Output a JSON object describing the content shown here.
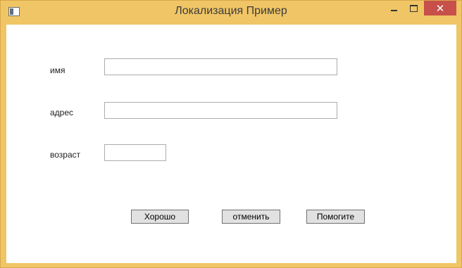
{
  "window": {
    "title": "Локализация Пример",
    "close_symbol": "✕",
    "accent_color": "#f0c566",
    "close_color": "#c7504a"
  },
  "form": {
    "name_label": "имя",
    "name_value": "",
    "address_label": "адрес",
    "address_value": "",
    "age_label": "возраст",
    "age_value": ""
  },
  "buttons": {
    "ok": "Хорошо",
    "cancel": "отменить",
    "help": "Помогите"
  }
}
